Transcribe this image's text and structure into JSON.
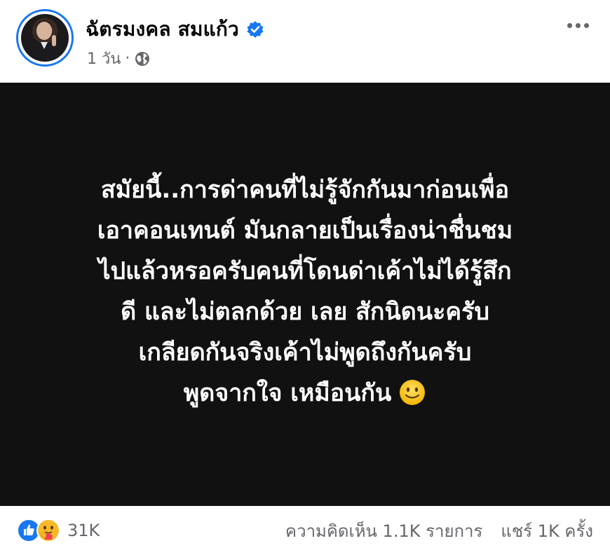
{
  "author": {
    "name": "ฉัตรมงคล สมแก้ว",
    "verified": true
  },
  "meta": {
    "time": "1 วัน",
    "separator": "·",
    "audience_icon": "globe-icon"
  },
  "post": {
    "background_color": "#111111",
    "text_color": "#ffffff",
    "lines": [
      "สมัยนี้..การด่าคนที่ไม่รู้จักกันมาก่อนเพื่อ",
      "เอาคอนเทนต์  มันกลายเป็นเรื่องน่าชื่นชม",
      "ไปแล้วหรอครับคนที่โดนด่าเค้าไม่ได้รู้สึก",
      "ดี และไม่ตลกด้วย เลย สักนิดนะครับ",
      "เกลียดกันจริงเค้าไม่พูดถึงกันครับ",
      "พูดจากใจ เหมือนกัน"
    ],
    "emoji_icon": "slightly-smiling-face-icon"
  },
  "footer": {
    "reaction_icons": [
      "like-icon",
      "care-icon"
    ],
    "reaction_count": "31K",
    "comments": "ความคิดเห็น 1.1K รายการ",
    "shares": "แชร์ 1K ครั้ง"
  },
  "colors": {
    "accent": "#1877f2",
    "secondary_text": "#65676b"
  }
}
